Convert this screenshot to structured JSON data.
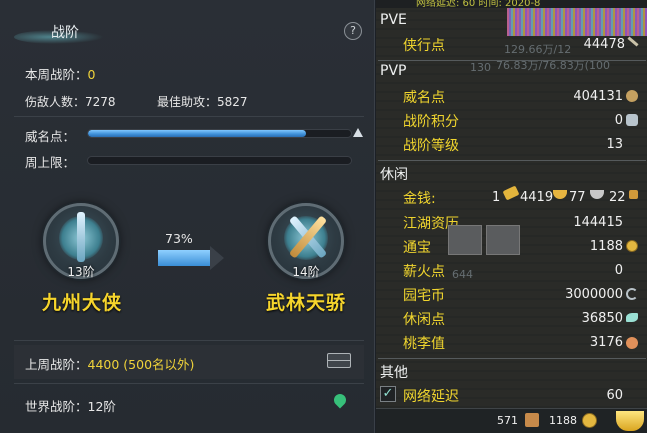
{
  "left": {
    "title": "战阶",
    "help": "?",
    "week_rank_label": "本周战阶：",
    "week_rank_value": "0",
    "kills_label": "伤敌人数：",
    "kills_value": "7278",
    "assist_label": "最佳助攻：",
    "assist_value": "5827",
    "prestige_label": "威名点：",
    "prestige_progress": 0.83,
    "week_cap_label": "周上限：",
    "week_cap_progress": 0.0,
    "current_rank": {
      "level": "13阶",
      "name": "九州大侠"
    },
    "next_rank": {
      "level": "14阶",
      "name": "武林天骄"
    },
    "progress_percent": "73%",
    "last_week_label": "上周战阶：",
    "last_week_value": "4400 (500名以外)",
    "world_rank_label": "世界战阶：",
    "world_rank_value": "12阶"
  },
  "right": {
    "topbar_text": "网络延迟: 60  时间: 2020-8",
    "sections": {
      "pve": "PVE",
      "pvp": "PVP",
      "leisure": "休闲",
      "other": "其他"
    },
    "pve_rows": [
      {
        "key": "侠行点",
        "value": "44478"
      }
    ],
    "pvp_rows": [
      {
        "key": "威名点",
        "value": "404131"
      },
      {
        "key": "战阶积分",
        "value": "0"
      },
      {
        "key": "战阶等级",
        "value": "13"
      }
    ],
    "money": {
      "key": "金钱:",
      "gold_bars": "1",
      "gold": "4419",
      "silver": "77",
      "copper": "22"
    },
    "leisure_rows": [
      {
        "key": "江湖资历",
        "value": "144415"
      },
      {
        "key": "通宝",
        "value": "1188"
      },
      {
        "key": "薪火点",
        "value": "0"
      },
      {
        "key": "园宅币",
        "value": "3000000"
      },
      {
        "key": "休闲点",
        "value": "36850"
      },
      {
        "key": "桃李值",
        "value": "3176"
      }
    ],
    "other_rows": [
      {
        "key": "网络延迟",
        "value": "60"
      }
    ],
    "background_text": {
      "hp": "129.66万/12",
      "mp": "76.83万/76.83万(100",
      "level": "130",
      "num": "644"
    },
    "bottom": {
      "count": "571",
      "coins": "1188"
    },
    "colors": {
      "key": "#f0d52e",
      "value": "#f0f0f0"
    }
  }
}
